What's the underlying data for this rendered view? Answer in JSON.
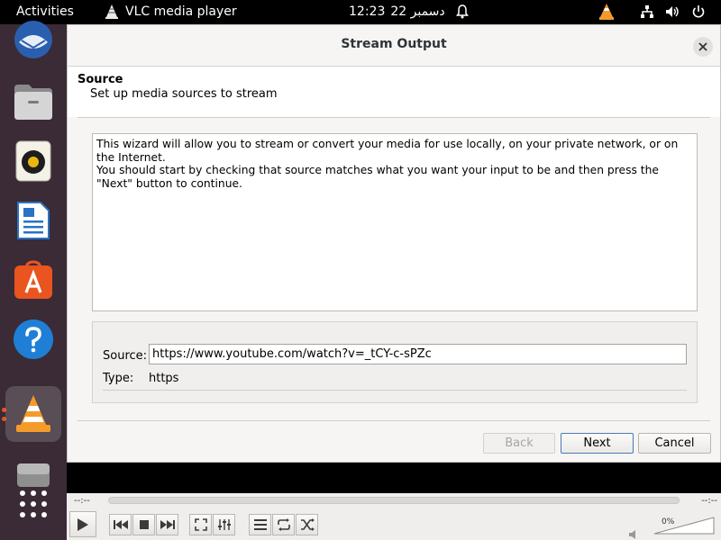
{
  "topbar": {
    "activities": "Activities",
    "app_name": "VLC media player",
    "clock_time": "12:23",
    "clock_date": "22 دسمبر",
    "icons": [
      "bell-icon",
      "vlc-tray-icon",
      "network-icon",
      "volume-icon",
      "power-icon"
    ]
  },
  "dock": {
    "items": [
      "thunderbird-icon",
      "files-icon",
      "rhythmbox-icon",
      "libreoffice-writer-icon",
      "app-center-icon",
      "help-icon",
      "vlc-icon",
      "disk-icon",
      "show-apps-icon"
    ],
    "accent": "#e9541f"
  },
  "dialog": {
    "title": "Stream Output",
    "section_title": "Source",
    "section_subtitle": "Set up media sources to stream",
    "info_line1": "This wizard will allow you to stream or convert your media for use locally, on your private network, or on the Internet.",
    "info_line2": "You should start by checking that source matches what you want your input to be and then press the \"Next\" button to continue.",
    "source_label": "Source:",
    "source_value": "https://www.youtube.com/watch?v=_tCY-c-sPZc",
    "type_label": "Type:",
    "type_value": "https",
    "buttons": {
      "back": "Back",
      "next": "Next",
      "cancel": "Cancel"
    }
  },
  "player": {
    "time_elapsed": "--:--",
    "time_total": "--:--",
    "volume": "0%",
    "volume_level": 0
  }
}
